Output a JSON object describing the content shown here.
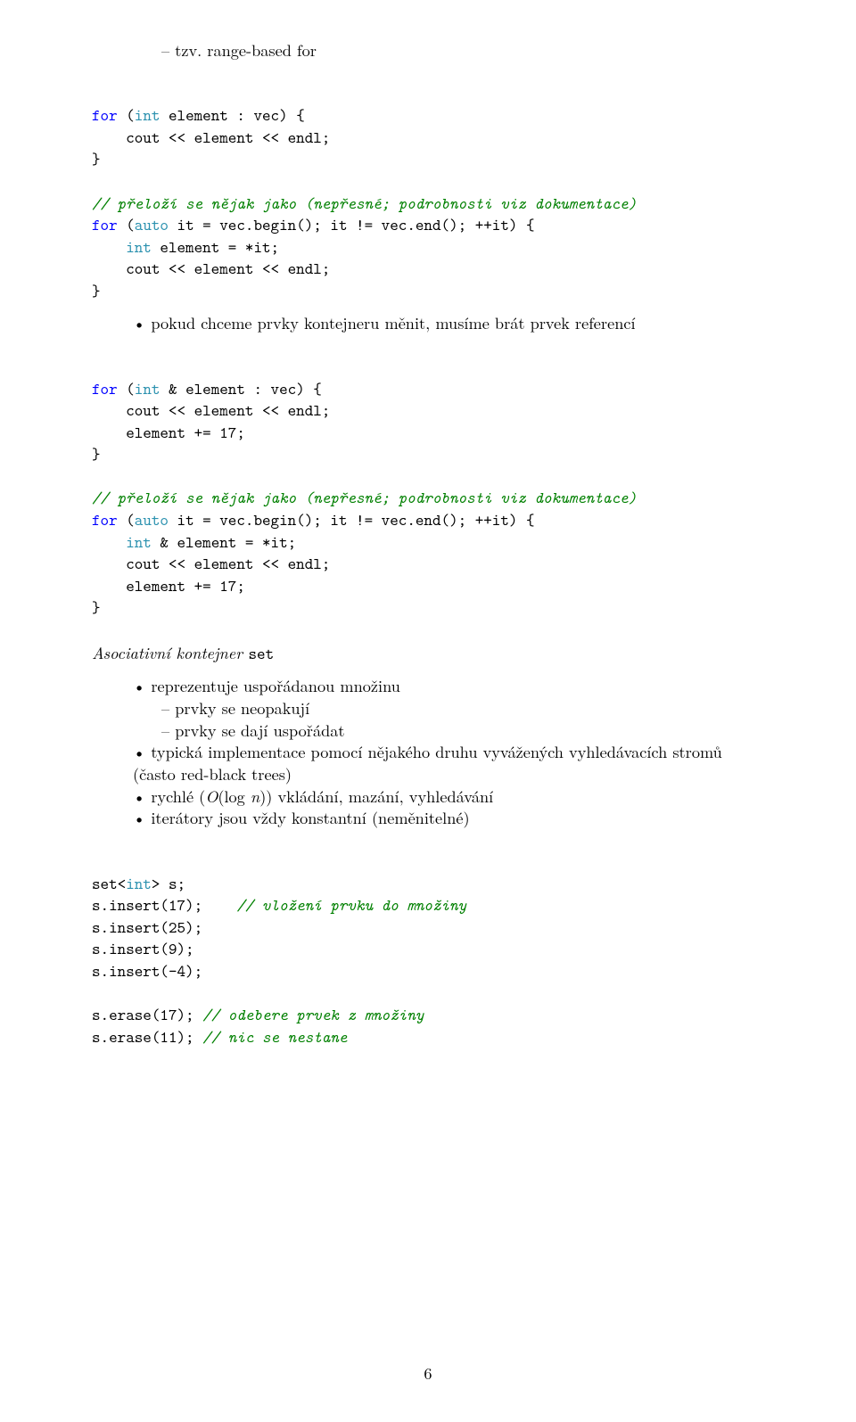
{
  "top_dash": "tzv. range-based for",
  "code1": {
    "l1a": "for",
    "l1b": " (",
    "l1c": "int",
    "l1d": " element : vec) {",
    "l2": "    cout << element << endl;",
    "l3": "}",
    "l5cmt": "// přeloží se nějak jako (nepřesné; podrobnosti viz dokumentace)",
    "l6a": "for",
    "l6b": " (",
    "l6c": "auto",
    "l6d": " it = vec.begin(); it != vec.end(); ++it) {",
    "l7a": "    ",
    "l7b": "int",
    "l7c": " element = *it;",
    "l8": "    cout << element << endl;",
    "l9": "}"
  },
  "bullet1": "pokud chceme prvky kontejneru měnit, musíme brát prvek referencí",
  "code2": {
    "l1a": "for",
    "l1b": " (",
    "l1c": "int",
    "l1d": " & element : vec) {",
    "l2": "    cout << element << endl;",
    "l3a": "    element += ",
    "l3b": "17",
    "l3c": ";",
    "l4": "}",
    "l6cmt": "// přeloží se nějak jako (nepřesné; podrobnosti viz dokumentace)",
    "l7a": "for",
    "l7b": " (",
    "l7c": "auto",
    "l7d": " it = vec.begin(); it != vec.end(); ++it) {",
    "l8a": "    ",
    "l8b": "int",
    "l8c": " & element = *it;",
    "l9": "    cout << element << endl;",
    "l10a": "    element += ",
    "l10b": "17",
    "l10c": ";",
    "l11": "}"
  },
  "section_title_pre": "Asociativní kontejner ",
  "section_title_mono": "set",
  "set_bul1": "reprezentuje uspořádanou množinu",
  "set_dash1": "prvky se neopakují",
  "set_dash2": "prvky se dají uspořádat",
  "set_bul2": "typická implementace pomocí nějakého druhu vyvážených vyhledávacích stromů (často red-black trees)",
  "set_bul3_pre": "rychlé (",
  "set_bul3_math": "O",
  "set_bul3_post1": "(log ",
  "set_bul3_math2": "n",
  "set_bul3_post2": ")) vkládání, mazání, vyhledávání",
  "set_bul4": "iterátory jsou vždy konstantní (neměnitelné)",
  "code3": {
    "l1a": "set<",
    "l1b": "int",
    "l1c": "> s;",
    "l2a": "s.insert(",
    "l2b": "17",
    "l2c": ");    ",
    "l2d": "// vložení prvku do množiny",
    "l3a": "s.insert(",
    "l3b": "25",
    "l3c": ");",
    "l4a": "s.insert(",
    "l4b": "9",
    "l4c": ");",
    "l5a": "s.insert(",
    "l5b": "-4",
    "l5c": ");",
    "l7a": "s.erase(",
    "l7b": "17",
    "l7c": "); ",
    "l7d": "// odebere prvek z množiny",
    "l8a": "s.erase(",
    "l8b": "11",
    "l8c": "); ",
    "l8d": "// nic se nestane"
  },
  "pagenum": "6"
}
